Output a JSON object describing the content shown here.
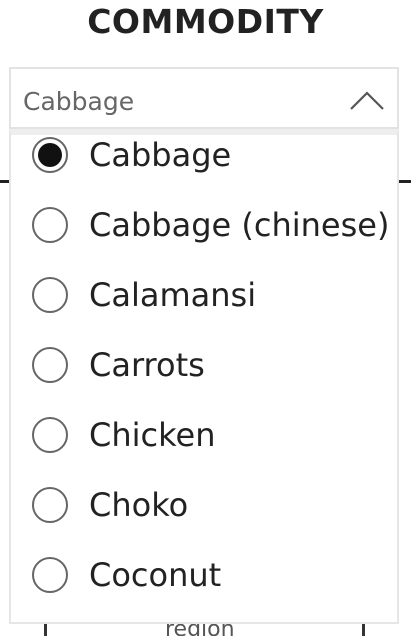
{
  "header": {
    "title": "COMMODITY"
  },
  "slicer": {
    "selected_value": "Cabbage",
    "chevron_icon": "chevron-up-icon",
    "options": [
      {
        "label": "Cabbage",
        "selected": true
      },
      {
        "label": "Cabbage (chinese)",
        "selected": false
      },
      {
        "label": "Calamansi",
        "selected": false
      },
      {
        "label": "Carrots",
        "selected": false
      },
      {
        "label": "Chicken",
        "selected": false
      },
      {
        "label": "Choko",
        "selected": false
      },
      {
        "label": "Coconut",
        "selected": false
      }
    ]
  },
  "background": {
    "axis_text": "region"
  },
  "colors": {
    "text": "#222222",
    "border": "#e3e3e3",
    "radio_ring": "#666666",
    "radio_fill": "#111111"
  }
}
